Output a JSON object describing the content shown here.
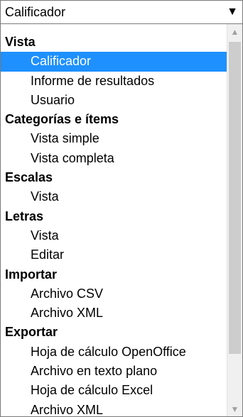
{
  "select": {
    "value": "Calificador",
    "arrow_icon": "dropdown-arrow-icon"
  },
  "groups": [
    {
      "label": "Vista",
      "options": [
        "Calificador",
        "Informe de resultados",
        "Usuario"
      ]
    },
    {
      "label": "Categorías e ítems",
      "options": [
        "Vista simple",
        "Vista completa"
      ]
    },
    {
      "label": "Escalas",
      "options": [
        "Vista"
      ]
    },
    {
      "label": "Letras",
      "options": [
        "Vista",
        "Editar"
      ]
    },
    {
      "label": "Importar",
      "options": [
        "Archivo CSV",
        "Archivo XML"
      ]
    },
    {
      "label": "Exportar",
      "options": [
        "Hoja de cálculo OpenOffice",
        "Archivo en texto plano",
        "Hoja de cálculo Excel",
        "Archivo XML"
      ]
    }
  ],
  "selected_option": "Calificador",
  "colors": {
    "selected_bg": "#1e90ff",
    "selected_text": "#ffffff"
  }
}
